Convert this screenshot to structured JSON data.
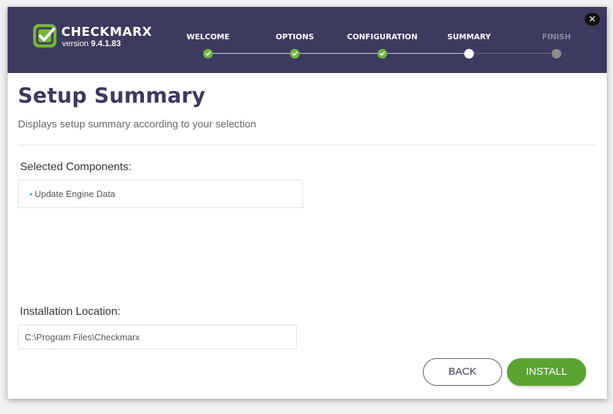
{
  "window": {
    "brand": "CHECKMARX",
    "version_prefix": "version",
    "version": "9.4.1.83",
    "close_glyph": "✕"
  },
  "steps": [
    {
      "label": "WELCOME",
      "state": "done"
    },
    {
      "label": "OPTIONS",
      "state": "done"
    },
    {
      "label": "CONFIGURATION",
      "state": "done"
    },
    {
      "label": "SUMMARY",
      "state": "current"
    },
    {
      "label": "FINISH",
      "state": "future"
    }
  ],
  "page": {
    "title": "Setup Summary",
    "subtitle": "Displays setup summary according to your selection"
  },
  "components": {
    "label": "Selected Components:",
    "items": [
      "Update Engine Data"
    ]
  },
  "location": {
    "label": "Installation Location:",
    "value": "C:\\Program Files\\Checkmarx"
  },
  "buttons": {
    "back": "BACK",
    "install": "INSTALL"
  },
  "colors": {
    "header_bg": "#3c3a5e",
    "accent_green": "#5ba332",
    "step_done": "#74b43c",
    "bullet_blue": "#2aa9e0"
  },
  "icons": {
    "logo": "checkmarx-logo-icon",
    "close": "close-icon",
    "step_done": "checkmark-icon"
  }
}
